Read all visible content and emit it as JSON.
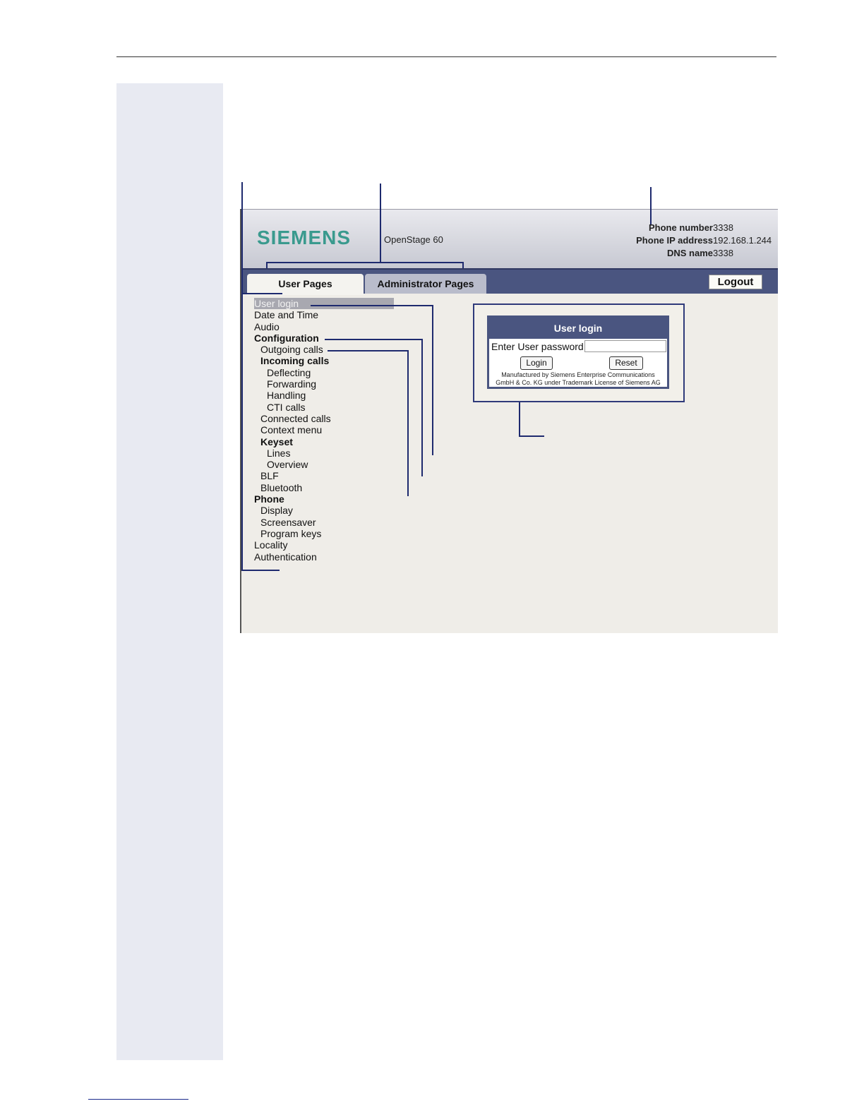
{
  "header": {
    "logo": "SIEMENS",
    "model": "OpenStage 60",
    "phone_number_label": "Phone number",
    "phone_number": "3338",
    "ip_label": "Phone IP address",
    "ip": "192.168.1.244",
    "dns_label": "DNS name",
    "dns": "3338"
  },
  "tabs": {
    "user": "User Pages",
    "admin": "Administrator Pages",
    "logout": "Logout"
  },
  "nav": [
    {
      "label": "User login",
      "level": 1,
      "bold": false,
      "selected": true
    },
    {
      "label": "Date and Time",
      "level": 1,
      "bold": false
    },
    {
      "label": "Audio",
      "level": 1,
      "bold": false
    },
    {
      "label": "Configuration",
      "level": 1,
      "bold": true
    },
    {
      "label": "Outgoing calls",
      "level": 2,
      "bold": false
    },
    {
      "label": "Incoming calls",
      "level": 2,
      "bold": true
    },
    {
      "label": "Deflecting",
      "level": 3,
      "bold": false
    },
    {
      "label": "Forwarding",
      "level": 3,
      "bold": false
    },
    {
      "label": "Handling",
      "level": 3,
      "bold": false
    },
    {
      "label": "CTI calls",
      "level": 3,
      "bold": false
    },
    {
      "label": "Connected calls",
      "level": 2,
      "bold": false
    },
    {
      "label": "Context menu",
      "level": 2,
      "bold": false
    },
    {
      "label": "Keyset",
      "level": 2,
      "bold": true
    },
    {
      "label": "Lines",
      "level": 3,
      "bold": false
    },
    {
      "label": "Overview",
      "level": 3,
      "bold": false
    },
    {
      "label": "BLF",
      "level": 2,
      "bold": false
    },
    {
      "label": "Bluetooth",
      "level": 2,
      "bold": false
    },
    {
      "label": "Phone",
      "level": 1,
      "bold": true
    },
    {
      "label": "Display",
      "level": 2,
      "bold": false
    },
    {
      "label": "Screensaver",
      "level": 2,
      "bold": false
    },
    {
      "label": "Program keys",
      "level": 2,
      "bold": false
    },
    {
      "label": "Locality",
      "level": 1,
      "bold": false
    },
    {
      "label": "Authentication",
      "level": 1,
      "bold": false
    }
  ],
  "login": {
    "title": "User login",
    "password_label": "Enter User password",
    "password_value": "",
    "login_button": "Login",
    "reset_button": "Reset",
    "fine_print_1": "Manufactured by Siemens Enterprise Communications",
    "fine_print_2": "GmbH & Co. KG under Trademark License of Siemens AG"
  },
  "colors": {
    "tab_bar": "#4a5580",
    "logo": "#3a9a8e",
    "callout": "#1e2a6e",
    "margin_column": "#e8eaf2"
  }
}
